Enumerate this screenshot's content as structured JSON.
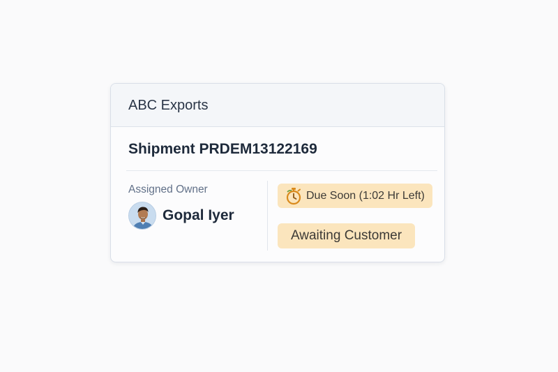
{
  "card": {
    "organization": "ABC Exports",
    "shipment_title": "Shipment PRDEM13122169",
    "owner": {
      "label": "Assigned Owner",
      "name": "Gopal Iyer"
    },
    "due_badge": {
      "icon": "stopwatch-icon",
      "text": "Due Soon (1:02 Hr Left)"
    },
    "status_badge": {
      "text": "Awaiting Customer"
    }
  },
  "colors": {
    "badge_background": "#fbe5bd",
    "timer_icon": "#d98a1c",
    "card_header_background": "#f4f6f9"
  }
}
